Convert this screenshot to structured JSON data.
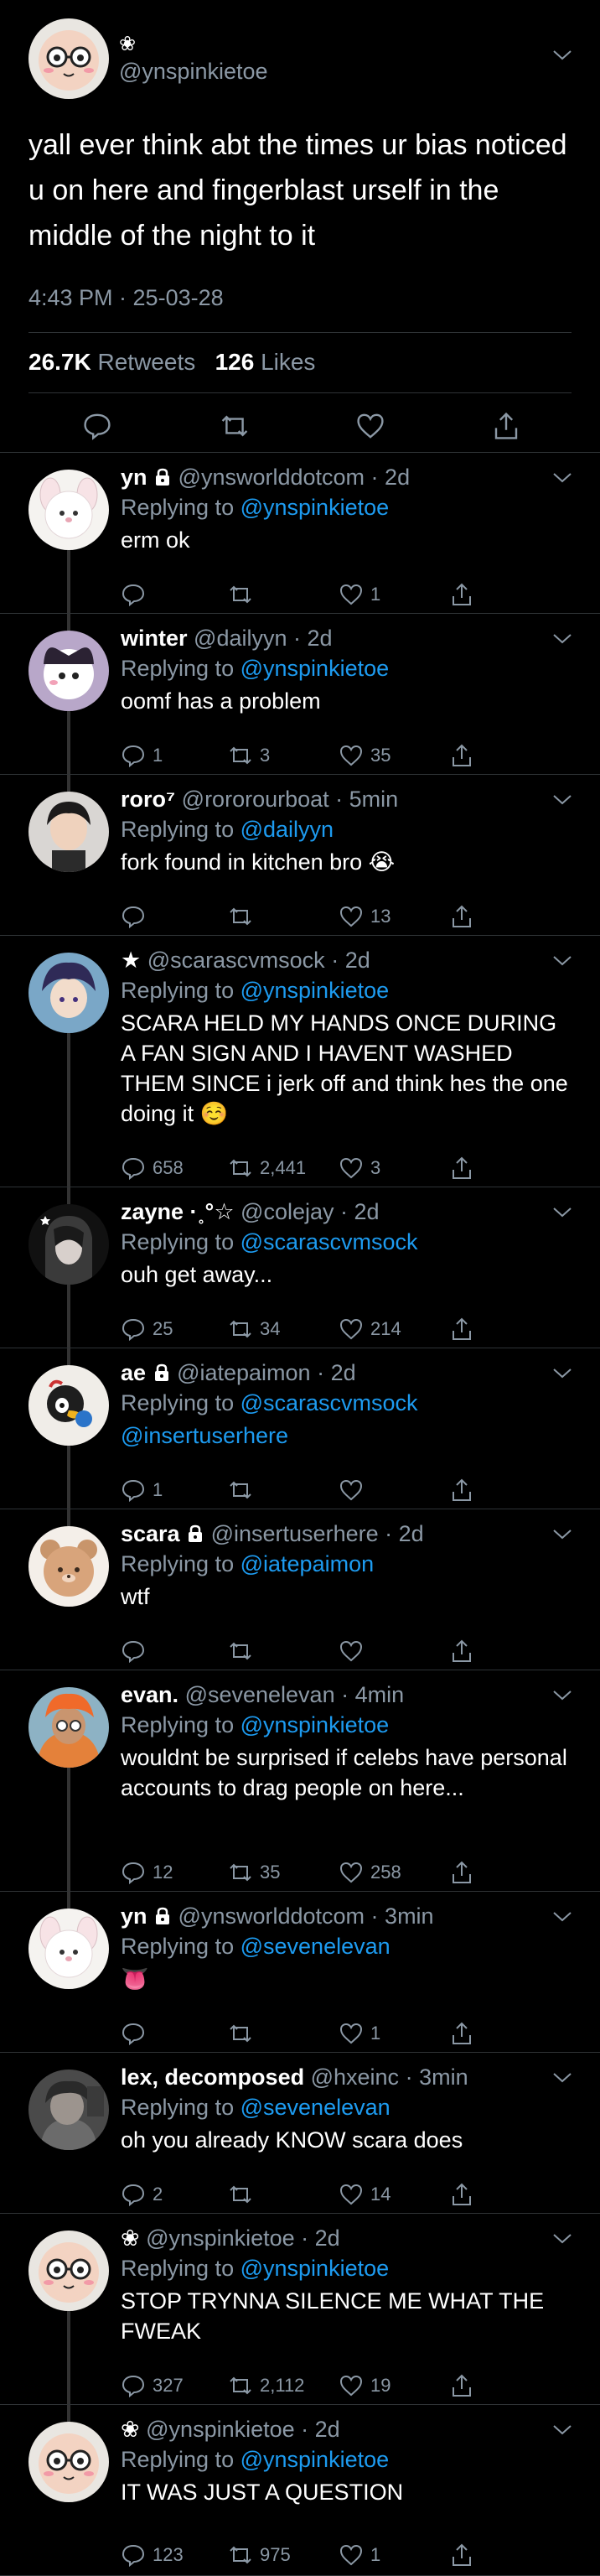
{
  "main": {
    "name": "❀",
    "handle": "@ynspinkietoe",
    "text": "yall ever think abt the times ur bias noticed u on here and fingerblast urself in the middle of the night to it",
    "time": "4:43 PM · 25-03-28",
    "retweets_count": "26.7K",
    "retweets_label": "Retweets",
    "likes_count": "126",
    "likes_label": "Likes"
  },
  "replies": [
    {
      "name": "yn",
      "handle": "@ynsworlddotcom",
      "age": "2d",
      "replying_label": "Replying to",
      "replying_to": "@ynspinkietoe",
      "text": "erm ok",
      "replies": "",
      "retweets": "",
      "likes": "1"
    },
    {
      "name": "winter",
      "handle": "@dailyyn",
      "age": "2d",
      "replying_label": "Replying to",
      "replying_to": "@ynspinkietoe",
      "text": "oomf has a problem",
      "replies": "1",
      "retweets": "3",
      "likes": "35"
    },
    {
      "name": "roro⁷",
      "handle": "@rororourboat",
      "age": "5min",
      "replying_label": "Replying to",
      "replying_to": "@dailyyn",
      "text": "fork found in kitchen bro 😭",
      "replies": "",
      "retweets": "",
      "likes": "13"
    },
    {
      "name": "★",
      "handle": "@scarascvmsock",
      "age": "2d",
      "replying_label": "Replying to",
      "replying_to": "@ynspinkietoe",
      "text": "SCARA HELD MY HANDS ONCE DURING A FAN SIGN AND I HAVENT WASHED THEM SINCE i jerk off and think hes the one doing it ☺️",
      "replies": "658",
      "retweets": "2,441",
      "likes": "3"
    },
    {
      "name": "zayne ·˳°☆",
      "handle": "@colejay",
      "age": "2d",
      "replying_label": "Replying to",
      "replying_to": "@scarascvmsock",
      "text": "ouh get away...",
      "replies": "25",
      "retweets": "34",
      "likes": "214"
    },
    {
      "name": "ae",
      "handle": "@iatepaimon",
      "age": "2d",
      "replying_label": "Replying to",
      "replying_to": "@scarascvmsock",
      "text": "@insertuserhere",
      "replies": "1",
      "retweets": "",
      "likes": ""
    },
    {
      "name": "scara",
      "handle": "@insertuserhere",
      "age": "2d",
      "replying_label": "Replying to",
      "replying_to": "@iatepaimon",
      "text": "wtf",
      "replies": "",
      "retweets": "",
      "likes": ""
    },
    {
      "name": "evan.",
      "handle": "@sevenelevan",
      "age": "4min",
      "replying_label": "Replying to",
      "replying_to": "@ynspinkietoe",
      "text": "wouldnt be surprised if celebs have personal accounts to drag people on here...",
      "replies": "12",
      "retweets": "35",
      "likes": "258"
    },
    {
      "name": "yn",
      "handle": "@ynsworlddotcom",
      "age": "3min",
      "replying_label": "Replying to",
      "replying_to": "@sevenelevan",
      "text": "👅",
      "replies": "",
      "retweets": "",
      "likes": "1"
    },
    {
      "name": "lex, decomposed",
      "handle": "@hxeinc",
      "age": "3min",
      "replying_label": "Replying to",
      "replying_to": "@sevenelevan",
      "text": "oh you already KNOW scara does",
      "replies": "2",
      "retweets": "",
      "likes": "14"
    },
    {
      "name": "❀",
      "handle": "@ynspinkietoe",
      "age": "2d",
      "replying_label": "Replying to",
      "replying_to": "@ynspinkietoe",
      "text": "STOP TRYNNA SILENCE ME WHAT THE FWEAK",
      "replies": "327",
      "retweets": "2,112",
      "likes": "19"
    },
    {
      "name": "❀",
      "handle": "@ynspinkietoe",
      "age": "2d",
      "replying_label": "Replying to",
      "replying_to": "@ynspinkietoe",
      "text": "IT WAS JUST A QUESTION",
      "replies": "123",
      "retweets": "975",
      "likes": "1"
    }
  ],
  "colors": {
    "accent": "#1d9bf0",
    "muted": "#8b98a5",
    "background": "#000000",
    "divider": "#2f3336"
  }
}
